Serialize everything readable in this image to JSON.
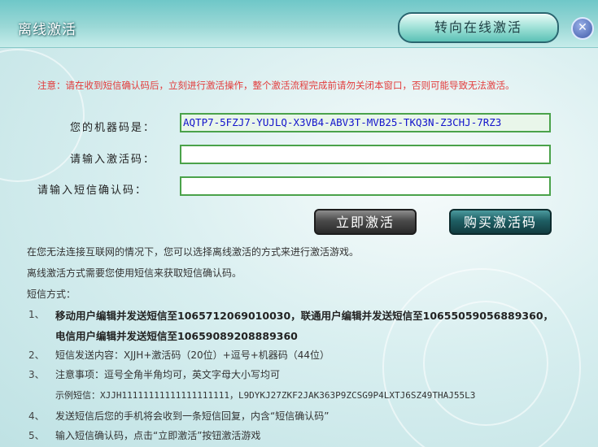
{
  "window": {
    "title": "离线激活",
    "online_button": "转向在线激活",
    "close_label": "✕"
  },
  "notice": "注意：请在收到短信确认码后，立刻进行激活操作，整个激活流程完成前请勿关闭本窗口，否则可能导致无法激活。",
  "form": {
    "machine_code_label": "您的机器码是：",
    "machine_code_value": "AQTP7-5FZJ7-YUJLQ-X3VB4-ABV3T-MVB25-TKQ3N-Z3CHJ-7RZ3",
    "activation_label": "请输入激活码：",
    "activation_value": "",
    "sms_label": "请输入短信确认码：",
    "sms_value": ""
  },
  "buttons": {
    "activate": "立即激活",
    "buy": "购买激活码"
  },
  "info": {
    "intro1": "在您无法连接互联网的情况下，您可以选择离线激活的方式来进行激活游戏。",
    "intro2": "离线激活方式需要您使用短信来获取短信确认码。",
    "sms_method_heading": "短信方式：",
    "step1_num": "1、",
    "step1_line1": "移动用户编辑并发送短信至1065712069010030，联通用户编辑并发送短信至10655059056889360，",
    "step1_line2": "电信用户编辑并发送短信至10659089208889360",
    "step2_num": "2、",
    "step2": "短信发送内容：XJJH+激活码（20位）+逗号+机器码（44位）",
    "step3_num": "3、",
    "step3": "注意事项：逗号全角半角均可，英文字母大小写均可",
    "example": "示例短信：XJJH11111111111111111111，L9DYKJ27ZKF2JAK363P9ZCSG9P4LXTJ6SZ49THAJ55L3",
    "step4_num": "4、",
    "step4": "发送短信后您的手机将会收到一条短信回复，内含“短信确认码”",
    "step5_num": "5、",
    "step5": "输入短信确认码，点击“立即激活”按钮激活游戏"
  }
}
